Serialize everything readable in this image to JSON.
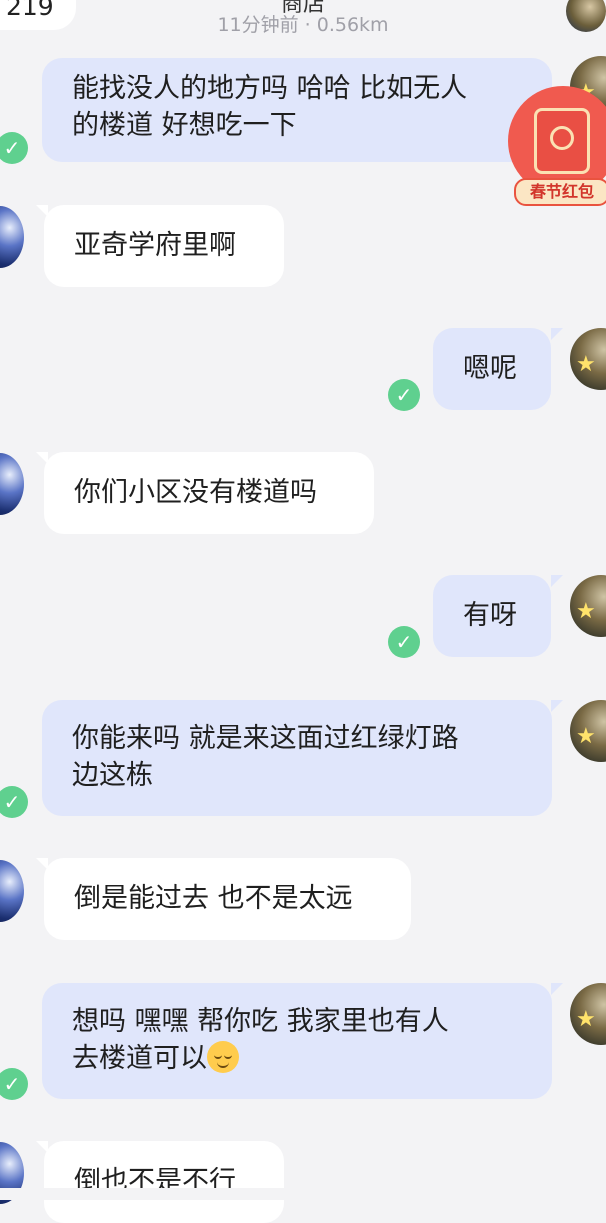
{
  "header": {
    "count": "219",
    "title": "商店",
    "subtitle": "11分钟前 · 0.56km"
  },
  "red_packet": {
    "label": "春节红包"
  },
  "messages": [
    {
      "side": "out",
      "lines": [
        "能找没人的地方吗 哈哈 比如无人",
        "的楼道 好想吃一下"
      ],
      "read": "✓"
    },
    {
      "side": "in",
      "lines": [
        "亚奇学府里啊"
      ]
    },
    {
      "side": "out",
      "lines": [
        "嗯呢"
      ],
      "read": "✓"
    },
    {
      "side": "in",
      "lines": [
        "你们小区没有楼道吗"
      ]
    },
    {
      "side": "out",
      "lines": [
        "有呀"
      ],
      "read": "✓"
    },
    {
      "side": "out",
      "lines": [
        "你能来吗 就是来这面过红绿灯路",
        "边这栋"
      ],
      "read": "✓"
    },
    {
      "side": "in",
      "lines": [
        "倒是能过去 也不是太远"
      ]
    },
    {
      "side": "out",
      "lines": [
        "想吗 嘿嘿 帮你吃 我家里也有人",
        "去楼道可以"
      ],
      "emoji": "relieved-face",
      "read": "✓"
    },
    {
      "side": "in",
      "lines": [
        "倒也不是不行"
      ]
    }
  ],
  "avatar_star": "★"
}
